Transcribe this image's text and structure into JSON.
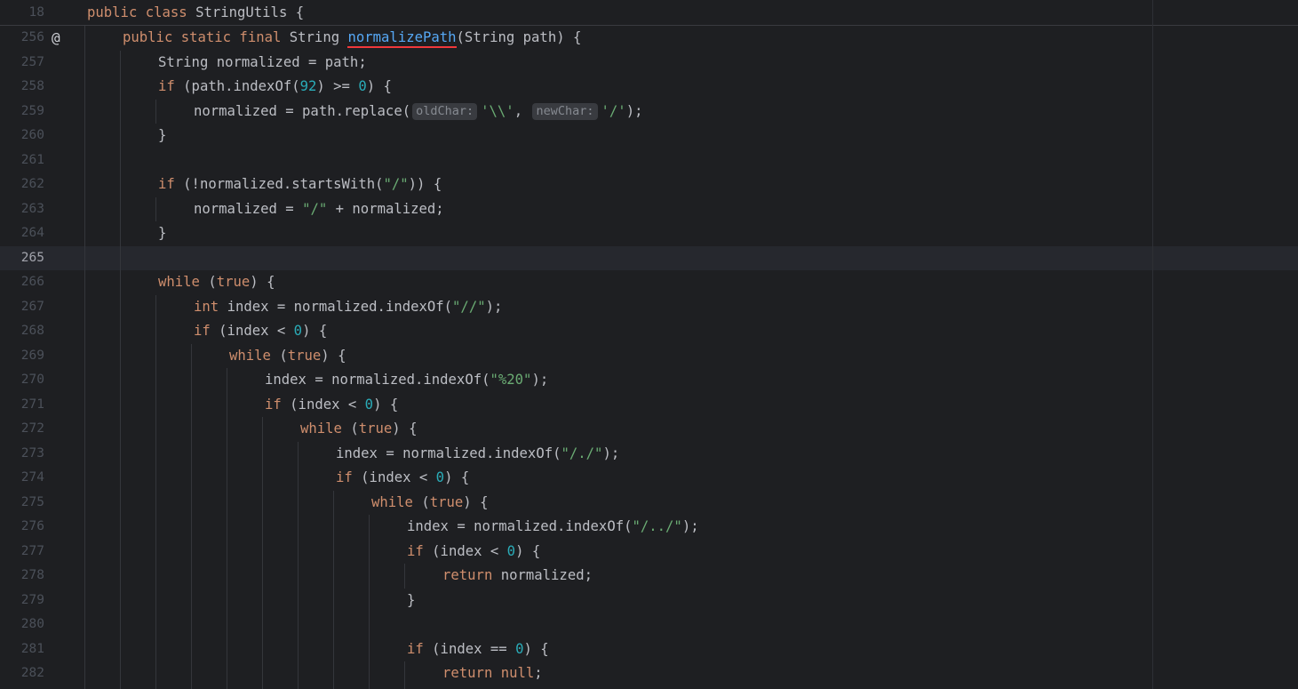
{
  "sticky": {
    "line_number": "18",
    "tokens": [
      {
        "t": "public class ",
        "c": "kw"
      },
      {
        "t": "StringUtils {",
        "c": "ident"
      }
    ]
  },
  "gutter_marker": "@",
  "lines": [
    {
      "n": "256",
      "indent": 1,
      "marker": true,
      "tokens": [
        {
          "t": "public static final ",
          "c": "kw"
        },
        {
          "t": "String ",
          "c": "ident"
        },
        {
          "t": "normalizePath",
          "c": "fn",
          "u": true
        },
        {
          "t": "(String path) {",
          "c": "ident"
        }
      ]
    },
    {
      "n": "257",
      "indent": 2,
      "tokens": [
        {
          "t": "String normalized = path;",
          "c": "ident"
        }
      ]
    },
    {
      "n": "258",
      "indent": 2,
      "tokens": [
        {
          "t": "if ",
          "c": "kw"
        },
        {
          "t": "(path.indexOf(",
          "c": "ident"
        },
        {
          "t": "92",
          "c": "num"
        },
        {
          "t": ") >= ",
          "c": "ident"
        },
        {
          "t": "0",
          "c": "num"
        },
        {
          "t": ") {",
          "c": "ident"
        }
      ]
    },
    {
      "n": "259",
      "indent": 3,
      "tokens": [
        {
          "t": "normalized = path.replace(",
          "c": "ident"
        },
        {
          "t": "oldChar:",
          "c": "hint"
        },
        {
          "t": "'\\\\'",
          "c": "str"
        },
        {
          "t": ", ",
          "c": "ident"
        },
        {
          "t": "newChar:",
          "c": "hint"
        },
        {
          "t": "'/'",
          "c": "str"
        },
        {
          "t": ");",
          "c": "ident"
        }
      ]
    },
    {
      "n": "260",
      "indent": 2,
      "tokens": [
        {
          "t": "}",
          "c": "ident"
        }
      ]
    },
    {
      "n": "261",
      "indent": 0,
      "tokens": []
    },
    {
      "n": "262",
      "indent": 2,
      "tokens": [
        {
          "t": "if ",
          "c": "kw"
        },
        {
          "t": "(!normalized.startsWith(",
          "c": "ident"
        },
        {
          "t": "\"/\"",
          "c": "str"
        },
        {
          "t": ")) {",
          "c": "ident"
        }
      ]
    },
    {
      "n": "263",
      "indent": 3,
      "tokens": [
        {
          "t": "normalized = ",
          "c": "ident"
        },
        {
          "t": "\"/\"",
          "c": "str"
        },
        {
          "t": " + normalized;",
          "c": "ident"
        }
      ]
    },
    {
      "n": "264",
      "indent": 2,
      "tokens": [
        {
          "t": "}",
          "c": "ident"
        }
      ]
    },
    {
      "n": "265",
      "indent": 0,
      "current": true,
      "tokens": []
    },
    {
      "n": "266",
      "indent": 2,
      "tokens": [
        {
          "t": "while ",
          "c": "kw"
        },
        {
          "t": "(",
          "c": "ident"
        },
        {
          "t": "true",
          "c": "kw"
        },
        {
          "t": ") {",
          "c": "ident"
        }
      ]
    },
    {
      "n": "267",
      "indent": 3,
      "tokens": [
        {
          "t": "int ",
          "c": "kw"
        },
        {
          "t": "index = normalized.indexOf(",
          "c": "ident"
        },
        {
          "t": "\"//\"",
          "c": "str"
        },
        {
          "t": ");",
          "c": "ident"
        }
      ]
    },
    {
      "n": "268",
      "indent": 3,
      "tokens": [
        {
          "t": "if ",
          "c": "kw"
        },
        {
          "t": "(index < ",
          "c": "ident"
        },
        {
          "t": "0",
          "c": "num"
        },
        {
          "t": ") {",
          "c": "ident"
        }
      ]
    },
    {
      "n": "269",
      "indent": 4,
      "tokens": [
        {
          "t": "while ",
          "c": "kw"
        },
        {
          "t": "(",
          "c": "ident"
        },
        {
          "t": "true",
          "c": "kw"
        },
        {
          "t": ") {",
          "c": "ident"
        }
      ]
    },
    {
      "n": "270",
      "indent": 5,
      "tokens": [
        {
          "t": "index = normalized.indexOf(",
          "c": "ident"
        },
        {
          "t": "\"%20\"",
          "c": "str"
        },
        {
          "t": ");",
          "c": "ident"
        }
      ]
    },
    {
      "n": "271",
      "indent": 5,
      "tokens": [
        {
          "t": "if ",
          "c": "kw"
        },
        {
          "t": "(index < ",
          "c": "ident"
        },
        {
          "t": "0",
          "c": "num"
        },
        {
          "t": ") {",
          "c": "ident"
        }
      ]
    },
    {
      "n": "272",
      "indent": 6,
      "tokens": [
        {
          "t": "while ",
          "c": "kw"
        },
        {
          "t": "(",
          "c": "ident"
        },
        {
          "t": "true",
          "c": "kw"
        },
        {
          "t": ") {",
          "c": "ident"
        }
      ]
    },
    {
      "n": "273",
      "indent": 7,
      "tokens": [
        {
          "t": "index = normalized.indexOf(",
          "c": "ident"
        },
        {
          "t": "\"/./\"",
          "c": "str"
        },
        {
          "t": ");",
          "c": "ident"
        }
      ]
    },
    {
      "n": "274",
      "indent": 7,
      "tokens": [
        {
          "t": "if ",
          "c": "kw"
        },
        {
          "t": "(index < ",
          "c": "ident"
        },
        {
          "t": "0",
          "c": "num"
        },
        {
          "t": ") {",
          "c": "ident"
        }
      ]
    },
    {
      "n": "275",
      "indent": 8,
      "tokens": [
        {
          "t": "while ",
          "c": "kw"
        },
        {
          "t": "(",
          "c": "ident"
        },
        {
          "t": "true",
          "c": "kw"
        },
        {
          "t": ") {",
          "c": "ident"
        }
      ]
    },
    {
      "n": "276",
      "indent": 9,
      "tokens": [
        {
          "t": "index = normalized.indexOf(",
          "c": "ident"
        },
        {
          "t": "\"/../\"",
          "c": "str"
        },
        {
          "t": ");",
          "c": "ident"
        }
      ]
    },
    {
      "n": "277",
      "indent": 9,
      "tokens": [
        {
          "t": "if ",
          "c": "kw"
        },
        {
          "t": "(index < ",
          "c": "ident"
        },
        {
          "t": "0",
          "c": "num"
        },
        {
          "t": ") {",
          "c": "ident"
        }
      ]
    },
    {
      "n": "278",
      "indent": 10,
      "tokens": [
        {
          "t": "return ",
          "c": "kw"
        },
        {
          "t": "normalized;",
          "c": "ident"
        }
      ]
    },
    {
      "n": "279",
      "indent": 9,
      "tokens": [
        {
          "t": "}",
          "c": "ident"
        }
      ]
    },
    {
      "n": "280",
      "indent": 0,
      "tokens": []
    },
    {
      "n": "281",
      "indent": 9,
      "tokens": [
        {
          "t": "if ",
          "c": "kw"
        },
        {
          "t": "(index == ",
          "c": "ident"
        },
        {
          "t": "0",
          "c": "num"
        },
        {
          "t": ") {",
          "c": "ident"
        }
      ]
    },
    {
      "n": "282",
      "indent": 10,
      "tokens": [
        {
          "t": "return ",
          "c": "kw"
        },
        {
          "t": "null",
          "c": "kw"
        },
        {
          "t": ";",
          "c": "ident"
        }
      ]
    }
  ],
  "colors": {
    "background": "#1e1f22",
    "keyword": "#cf8e6d",
    "number": "#2aacb8",
    "string": "#6aab73",
    "function": "#56a8f5",
    "identifier": "#bcbec4",
    "underline": "#f0383b"
  },
  "icons": {
    "gutter_marker": "override-annotation-icon"
  }
}
